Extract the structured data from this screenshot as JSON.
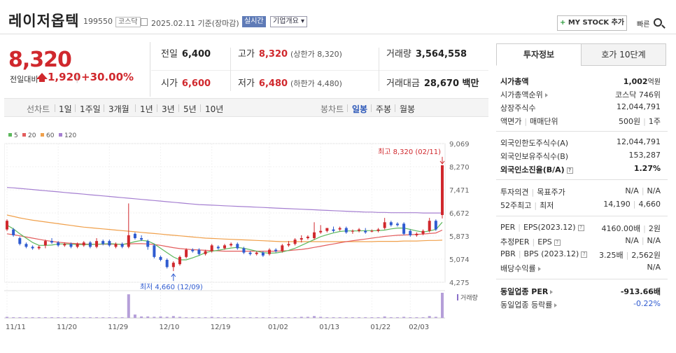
{
  "header": {
    "name": "레이저옵텍",
    "code": "199550",
    "market": "코스닥",
    "date": "2025.02.11 기준(장마감)",
    "realtime_label": "실시간",
    "overview_label": "기업개요",
    "mystock_label": "MY STOCK 추가",
    "fast_label": "빠른"
  },
  "price": {
    "current": "8,320",
    "compare_label": "전일대비",
    "change": "1,920",
    "rate": "+30.00%"
  },
  "stats": {
    "prev_label": "전일",
    "prev": "6,400",
    "high_label": "고가",
    "high": "8,320",
    "upper_limit": "(상한가 8,320)",
    "volume_label": "거래량",
    "volume": "3,564,558",
    "open_label": "시가",
    "open": "6,600",
    "low_label": "저가",
    "low": "6,480",
    "lower_limit": "(하한가 4,480)",
    "amount_label": "거래대금",
    "amount": "28,670 백만"
  },
  "periods": {
    "line_label": "선차트",
    "items": [
      "1일",
      "1주일",
      "3개월",
      "1년",
      "3년",
      "5년",
      "10년"
    ],
    "candle_label": "봉차트",
    "candle_items": [
      "일봉",
      "주봉",
      "월봉"
    ]
  },
  "colors": {
    "up": "#d0282d",
    "down": "#2f5bd0",
    "ma5": "#5cb85c",
    "ma20": "#e35d5d",
    "ma60": "#f0a04b",
    "ma120": "#a57fd1"
  },
  "chart_data": {
    "type": "candlestick",
    "ylim": [
      4275,
      9069
    ],
    "y_ticks": [
      "9,069",
      "8,270",
      "7,471",
      "6,672",
      "5,873",
      "5,074",
      "4,275"
    ],
    "x_ticks": [
      "11/11",
      "11/20",
      "11/29",
      "12/10",
      "12/19",
      "01/02",
      "01/13",
      "01/22",
      "02/03"
    ],
    "legend": [
      "5",
      "20",
      "60",
      "120"
    ],
    "high_label": "최고 8,320 (02/11)",
    "low_label": "최저 4,660 (12/09)",
    "volume_label": "거래량",
    "candles": [
      [
        6100,
        6400,
        6050,
        6450
      ],
      [
        6100,
        5900,
        5850,
        6150
      ],
      [
        5800,
        5600,
        5550,
        5850
      ],
      [
        5600,
        5500,
        5450,
        5650
      ],
      [
        5500,
        5450,
        5400,
        5550
      ],
      [
        5450,
        5500,
        5400,
        5550
      ],
      [
        5550,
        5700,
        5450,
        5750
      ],
      [
        5700,
        5650,
        5600,
        5800
      ],
      [
        5650,
        5550,
        5500,
        5700
      ],
      [
        5550,
        5600,
        5500,
        5650
      ],
      [
        5600,
        5500,
        5450,
        5650
      ],
      [
        5500,
        5600,
        5450,
        5650
      ],
      [
        5550,
        5650,
        5500,
        5700
      ],
      [
        5650,
        5500,
        5450,
        5700
      ],
      [
        5500,
        5700,
        5450,
        5800
      ],
      [
        5700,
        5600,
        5550,
        5750
      ],
      [
        5700,
        5550,
        5500,
        5750
      ],
      [
        5500,
        5600,
        5450,
        5650
      ],
      [
        5600,
        5500,
        5450,
        5650
      ],
      [
        5500,
        5900,
        5450,
        7000
      ],
      [
        5950,
        5800,
        5750,
        6000
      ],
      [
        5800,
        5750,
        5700,
        5900
      ],
      [
        5700,
        5500,
        5400,
        5750
      ],
      [
        5550,
        5150,
        5100,
        5600
      ],
      [
        5150,
        5050,
        5000,
        5200
      ],
      [
        5050,
        4800,
        4750,
        5100
      ],
      [
        4800,
        4950,
        4660,
        5000
      ],
      [
        4900,
        5150,
        4850,
        5200
      ],
      [
        5150,
        5400,
        5100,
        5450
      ],
      [
        5400,
        5350,
        5300,
        5450
      ],
      [
        5400,
        5250,
        5200,
        5450
      ],
      [
        5250,
        5350,
        5200,
        5400
      ],
      [
        5350,
        5550,
        5300,
        5600
      ],
      [
        5500,
        5450,
        5400,
        5550
      ],
      [
        5450,
        5550,
        5400,
        5600
      ],
      [
        5550,
        5600,
        5500,
        5650
      ],
      [
        5600,
        5450,
        5400,
        5650
      ],
      [
        5450,
        5300,
        5250,
        5500
      ],
      [
        5300,
        5250,
        5200,
        5350
      ],
      [
        5250,
        5300,
        5200,
        5350
      ],
      [
        5300,
        5200,
        5150,
        5350
      ],
      [
        5250,
        5400,
        5200,
        5450
      ],
      [
        5400,
        5350,
        5300,
        5450
      ],
      [
        5350,
        5550,
        5300,
        5600
      ],
      [
        5550,
        5600,
        5500,
        5700
      ],
      [
        5600,
        5750,
        5550,
        5800
      ],
      [
        5750,
        5800,
        5650,
        5900
      ],
      [
        5800,
        5850,
        5750,
        5900
      ],
      [
        5800,
        6000,
        5750,
        6350
      ],
      [
        6000,
        6050,
        5950,
        6250
      ],
      [
        6050,
        6150,
        6000,
        6150
      ],
      [
        6100,
        6050,
        6000,
        6200
      ],
      [
        6100,
        6150,
        6050,
        6200
      ],
      [
        6150,
        6000,
        5950,
        6200
      ],
      [
        6050,
        6050,
        5950,
        6100
      ],
      [
        6050,
        6100,
        6000,
        6150
      ],
      [
        6050,
        6000,
        5950,
        6150
      ],
      [
        6050,
        6050,
        6000,
        6100
      ],
      [
        6050,
        6100,
        6000,
        6150
      ],
      [
        6150,
        6350,
        6100,
        6500
      ],
      [
        6350,
        6250,
        6200,
        6400
      ],
      [
        6300,
        6250,
        6200,
        6350
      ],
      [
        6300,
        5950,
        5900,
        6350
      ],
      [
        6050,
        5900,
        5850,
        6100
      ],
      [
        5900,
        5950,
        5850,
        6000
      ],
      [
        5950,
        6050,
        5900,
        6100
      ],
      [
        6050,
        6400,
        6000,
        6500
      ],
      [
        6400,
        6100,
        6050,
        6450
      ],
      [
        6600,
        8320,
        6480,
        8320
      ]
    ],
    "ma5": [
      6250,
      6120,
      5950,
      5800,
      5650,
      5550,
      5550,
      5560,
      5600,
      5600,
      5590,
      5580,
      5580,
      5580,
      5590,
      5600,
      5610,
      5600,
      5580,
      5620,
      5680,
      5720,
      5700,
      5600,
      5450,
      5300,
      5150,
      5050,
      5050,
      5120,
      5200,
      5300,
      5350,
      5380,
      5420,
      5460,
      5480,
      5450,
      5400,
      5350,
      5300,
      5280,
      5290,
      5320,
      5380,
      5450,
      5550,
      5650,
      5750,
      5850,
      5920,
      5980,
      6030,
      6050,
      6050,
      6050,
      6060,
      6060,
      6060,
      6080,
      6120,
      6150,
      6150,
      6100,
      6050,
      6010,
      6050,
      6100,
      6350
    ],
    "ma20": [
      5950,
      5920,
      5880,
      5840,
      5800,
      5760,
      5720,
      5690,
      5660,
      5640,
      5620,
      5610,
      5600,
      5590,
      5590,
      5590,
      5590,
      5590,
      5590,
      5600,
      5610,
      5610,
      5600,
      5580,
      5550,
      5510,
      5470,
      5440,
      5420,
      5400,
      5390,
      5380,
      5370,
      5360,
      5350,
      5350,
      5350,
      5350,
      5350,
      5350,
      5350,
      5350,
      5350,
      5360,
      5370,
      5390,
      5410,
      5440,
      5480,
      5520,
      5560,
      5600,
      5640,
      5680,
      5710,
      5740,
      5770,
      5800,
      5830,
      5860,
      5880,
      5900,
      5910,
      5920,
      5930,
      5940,
      5960,
      5980,
      6080
    ],
    "ma60": [
      6600,
      6550,
      6500,
      6460,
      6420,
      6390,
      6360,
      6330,
      6300,
      6270,
      6240,
      6210,
      6180,
      6160,
      6140,
      6120,
      6100,
      6080,
      6060,
      6040,
      6020,
      6000,
      5980,
      5960,
      5940,
      5920,
      5900,
      5880,
      5860,
      5840,
      5820,
      5800,
      5790,
      5780,
      5770,
      5760,
      5750,
      5740,
      5730,
      5720,
      5710,
      5700,
      5690,
      5680,
      5680,
      5680,
      5680,
      5680,
      5680,
      5680,
      5680,
      5680,
      5680,
      5680,
      5680,
      5680,
      5680,
      5680,
      5690,
      5690,
      5690,
      5690,
      5700,
      5700,
      5700,
      5710,
      5720,
      5720,
      5730
    ],
    "ma120": [
      7550,
      7540,
      7520,
      7500,
      7480,
      7460,
      7440,
      7420,
      7400,
      7380,
      7360,
      7340,
      7320,
      7300,
      7280,
      7260,
      7240,
      7220,
      7200,
      7180,
      7160,
      7140,
      7120,
      7100,
      7080,
      7060,
      7040,
      7020,
      7000,
      6980,
      6960,
      6950,
      6940,
      6930,
      6920,
      6910,
      6900,
      6890,
      6880,
      6870,
      6860,
      6850,
      6840,
      6830,
      6820,
      6810,
      6800,
      6790,
      6780,
      6770,
      6760,
      6750,
      6740,
      6730,
      6720,
      6710,
      6700,
      6700,
      6690,
      6690,
      6680,
      6680,
      6680,
      6680,
      6680,
      6670,
      6670,
      6670,
      6670
    ],
    "volume": [
      3,
      2,
      2,
      2,
      2,
      2,
      2,
      2,
      2,
      2,
      2,
      2,
      2,
      2,
      2,
      2,
      2,
      2,
      2,
      62,
      9,
      4,
      4,
      3,
      4,
      3,
      5,
      3,
      2,
      2,
      2,
      2,
      3,
      2,
      2,
      2,
      2,
      2,
      2,
      2,
      2,
      2,
      2,
      2,
      2,
      2,
      3,
      3,
      5,
      3,
      2,
      2,
      2,
      2,
      2,
      2,
      2,
      2,
      2,
      4,
      2,
      2,
      3,
      2,
      2,
      2,
      5,
      3,
      66
    ]
  },
  "invest": {
    "tab_active": "투자정보",
    "tab_other": "호가 10단계",
    "mcap_label": "시가총액",
    "mcap_value": "1,002",
    "mcap_unit": "억원",
    "mcap_rank_label": "시가총액순위",
    "mcap_rank": "코스닥 746위",
    "shares_label": "상장주식수",
    "shares": "12,044,791",
    "par_label": "액면가",
    "unit_label": "매매단위",
    "par": "500원",
    "unit": "1주",
    "foreign_limit_label": "외국인한도주식수(A)",
    "foreign_limit": "12,044,791",
    "foreign_hold_label": "외국인보유주식수(B)",
    "foreign_hold": "153,287",
    "foreign_rate_label": "외국인소진율(B/A)",
    "foreign_rate": "1.27%",
    "opinion_label": "투자의견",
    "target_label": "목표주가",
    "opinion": "N/A",
    "target": "N/A",
    "w52_label": "52주최고",
    "w52_low_label": "최저",
    "w52_high": "14,190",
    "w52_low": "4,660",
    "per_label": "PER",
    "eps_label": "EPS(2023.12)",
    "per": "4160.00배",
    "eps": "2원",
    "est_per_label": "추정PER",
    "est_eps_label": "EPS",
    "est_per": "N/A",
    "est_eps": "N/A",
    "pbr_label": "PBR",
    "bps_label": "BPS (2023.12)",
    "pbr": "3.25배",
    "bps": "2,562원",
    "div_label": "배당수익률",
    "div": "N/A",
    "sector_per_label": "동일업종 PER",
    "sector_per": "-913.66배",
    "sector_rate_label": "동일업종 등락률",
    "sector_rate": "-0.22%"
  }
}
